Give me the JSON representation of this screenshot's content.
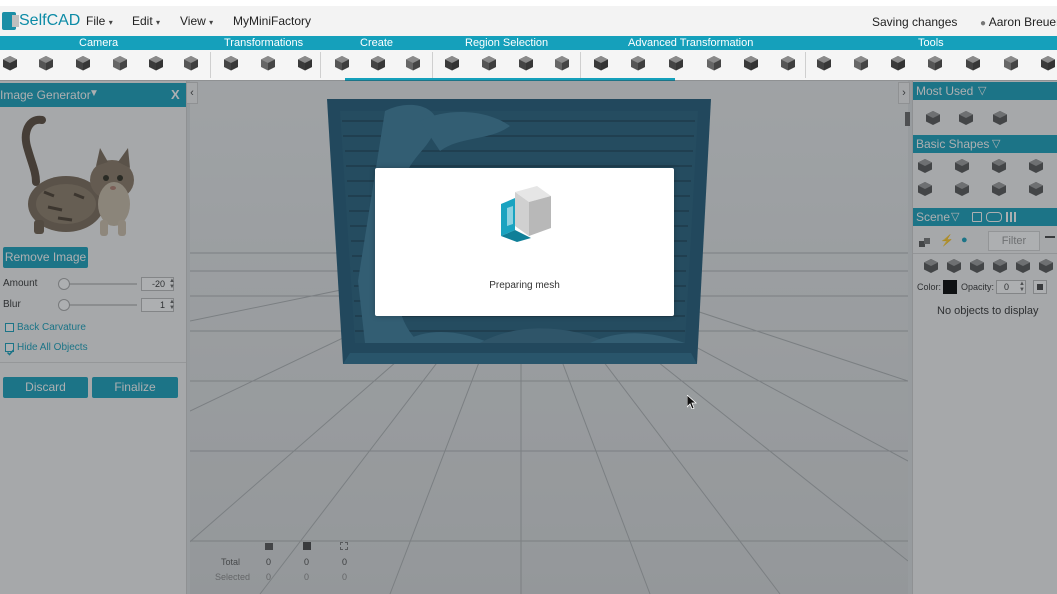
{
  "app": {
    "logo_text": "SelfCAD"
  },
  "menu": {
    "items": [
      {
        "label": "File",
        "has_caret": true
      },
      {
        "label": "Edit",
        "has_caret": true
      },
      {
        "label": "View",
        "has_caret": true
      },
      {
        "label": "MyMiniFactory",
        "has_caret": false
      }
    ],
    "status": "Saving changes",
    "user": "Aaron Breuer"
  },
  "categories": [
    "Camera",
    "Transformations",
    "Create",
    "Region Selection",
    "Advanced Transformation",
    "Tools"
  ],
  "left_panel": {
    "title": "Image Generator",
    "close_label": "X",
    "remove_image_label": "Remove Image",
    "amount_label": "Amount",
    "amount_value": "-20",
    "blur_label": "Blur",
    "blur_value": "1",
    "back_curvature_label": "Back Carvature",
    "back_curvature_checked": false,
    "hide_all_label": "Hide All Objects",
    "hide_all_checked": true,
    "discard_label": "Discard",
    "finalize_label": "Finalize"
  },
  "right_panel": {
    "most_used_title": "Most Used",
    "basic_shapes_title": "Basic Shapes",
    "scene_title": "Scene",
    "filter_placeholder": "Filter",
    "color_label": "Color:",
    "color_value": "#000000",
    "opacity_label": "Opacity:",
    "opacity_value": "0",
    "empty_text": "No objects to display"
  },
  "stats": {
    "total_label": "Total",
    "selected_label": "Selected",
    "total_values": [
      "0",
      "0",
      "0"
    ],
    "selected_values": [
      "0",
      "0",
      "0"
    ]
  },
  "modal": {
    "text": "Preparing mesh"
  },
  "colors": {
    "accent": "#15a0bb",
    "model": "#1f5a78"
  }
}
